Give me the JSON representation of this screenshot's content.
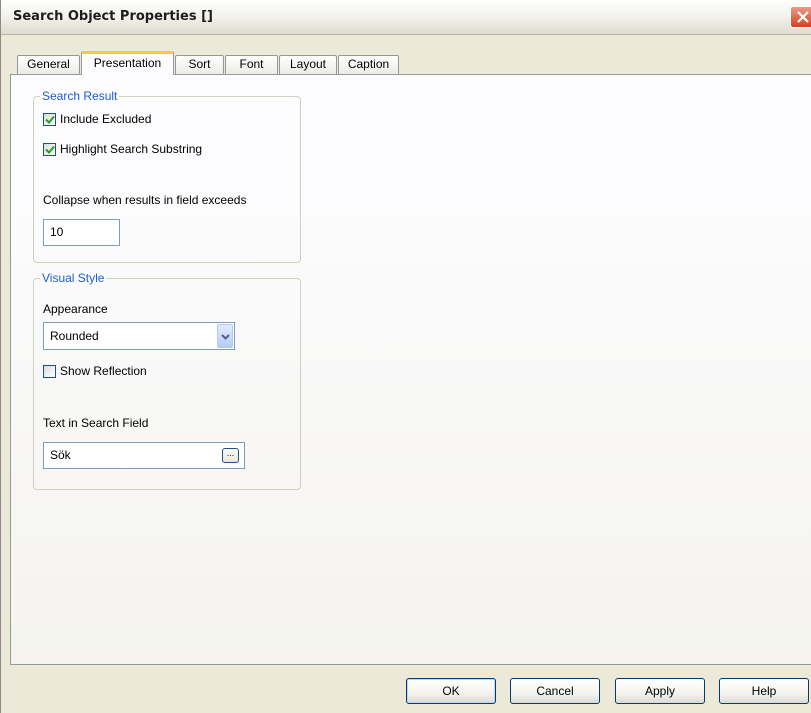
{
  "window": {
    "title": "Search Object Properties []"
  },
  "tabs": [
    {
      "label": "General"
    },
    {
      "label": "Presentation",
      "active": true
    },
    {
      "label": "Sort"
    },
    {
      "label": "Font"
    },
    {
      "label": "Layout"
    },
    {
      "label": "Caption"
    }
  ],
  "search_result": {
    "title": "Search Result",
    "include_excluded": {
      "label": "Include Excluded",
      "checked": true
    },
    "highlight_substring": {
      "label": "Highlight Search Substring",
      "checked": true
    },
    "collapse_label": "Collapse when results in field exceeds",
    "collapse_value": "10"
  },
  "visual_style": {
    "title": "Visual Style",
    "appearance_label": "Appearance",
    "appearance_value": "Rounded",
    "show_reflection": {
      "label": "Show Reflection",
      "checked": false
    },
    "text_label": "Text in Search Field",
    "text_value": "Sök",
    "ellipsis": "..."
  },
  "buttons": {
    "ok": "OK",
    "cancel": "Cancel",
    "apply": "Apply",
    "help": "Help"
  },
  "colors": {
    "accent": "#1d5bcf",
    "tab_highlight": "#ffc73c",
    "close": "#d3421f"
  },
  "icons": {
    "close": "close-icon",
    "checkmark": "checkmark-icon",
    "dropdown": "chevron-down-icon"
  }
}
